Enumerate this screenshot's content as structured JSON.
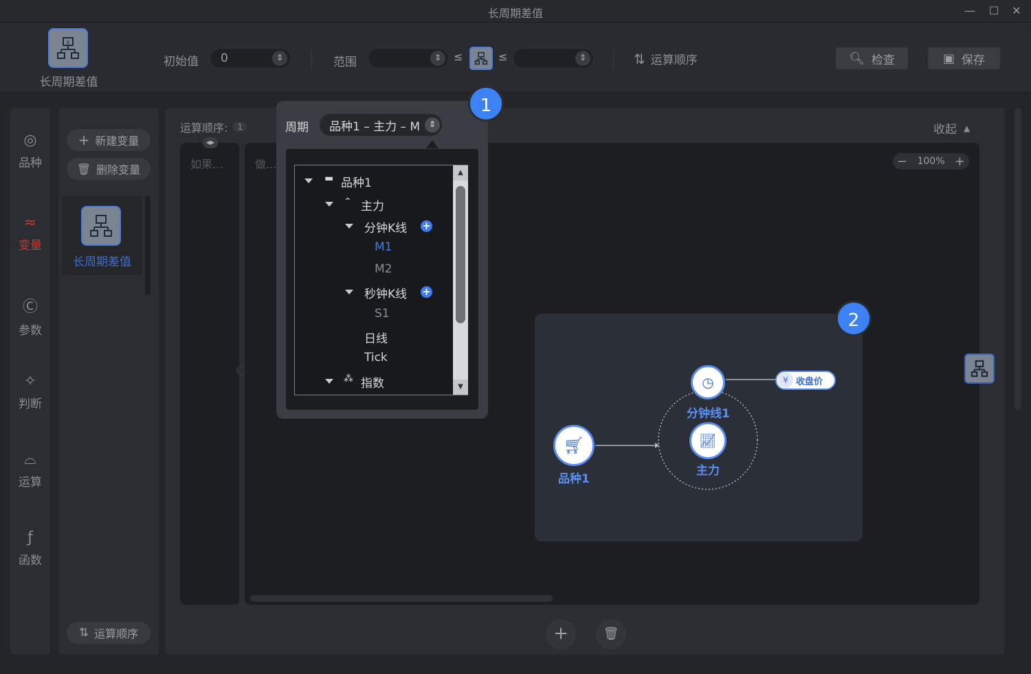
{
  "window": {
    "title": "长周期差值",
    "minimize": "—",
    "maximize": "☐",
    "close": "✕"
  },
  "toolbar": {
    "var_name": "长周期差值",
    "initial_label": "初始值",
    "initial_value": "0",
    "range_label": "范围",
    "le1": "≤",
    "le2": "≤",
    "order_label": "运算顺序",
    "check_label": "检查",
    "save_label": "保存"
  },
  "sidebar": {
    "items": [
      {
        "label": "品种",
        "icon": "variety-icon"
      },
      {
        "label": "变量",
        "icon": "variable-icon"
      },
      {
        "label": "参数",
        "icon": "parameter-icon"
      },
      {
        "label": "判断",
        "icon": "judge-icon"
      },
      {
        "label": "运算",
        "icon": "operation-icon"
      },
      {
        "label": "函数",
        "icon": "function-icon"
      }
    ]
  },
  "varpanel": {
    "new_label": "新建变量",
    "delete_label": "删除变量",
    "selected_var": "长周期差值",
    "order_label": "运算顺序"
  },
  "main": {
    "order_prefix": "运算顺序:",
    "order_value": "1",
    "collapse_label": "收起",
    "if_col": "如果...",
    "do_col": "做...",
    "zoom": "100%"
  },
  "popover": {
    "badge": "1",
    "period_label": "周期",
    "period_value": "品种1 – 主力 – M",
    "tree": {
      "root": "品种1",
      "main": "主力",
      "minute_k": "分钟K线",
      "m1": "M1",
      "m2": "M2",
      "second_k": "秒钟K线",
      "s1": "S1",
      "daily": "日线",
      "tick": "Tick",
      "index": "指数"
    }
  },
  "graph": {
    "badge": "2",
    "variety": "品种1",
    "minute_line": "分钟线1",
    "main": "主力",
    "close_tag": "收盘价",
    "yen": "¥"
  },
  "colors": {
    "accent": "#3c82f5",
    "active_nav": "#c8392e",
    "bg": "#232529"
  }
}
